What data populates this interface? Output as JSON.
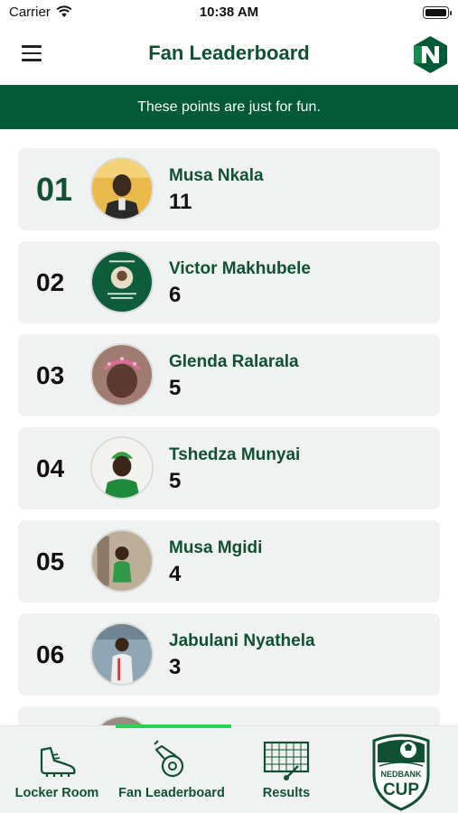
{
  "status_bar": {
    "carrier": "Carrier",
    "time": "10:38 AM"
  },
  "header": {
    "title": "Fan Leaderboard",
    "menu_icon": "hamburger-menu-icon",
    "logo": "nedbank-logo"
  },
  "banner": {
    "text": "These points are just for fun."
  },
  "leaderboard": [
    {
      "rank": "01",
      "name": "Musa Nkala",
      "points": "11",
      "avatar": "photo"
    },
    {
      "rank": "02",
      "name": "Victor Makhubele",
      "points": "6",
      "avatar": "card"
    },
    {
      "rank": "03",
      "name": "Glenda Ralarala",
      "points": "5",
      "avatar": "photo"
    },
    {
      "rank": "04",
      "name": "Tshedza Munyai",
      "points": "5",
      "avatar": "photo"
    },
    {
      "rank": "05",
      "name": "Musa Mgidi",
      "points": "4",
      "avatar": "photo"
    },
    {
      "rank": "06",
      "name": "Jabulani Nyathela",
      "points": "3",
      "avatar": "photo"
    }
  ],
  "tabs": [
    {
      "label": "Locker Room",
      "icon": "boot-icon"
    },
    {
      "label": "Fan Leaderboard",
      "icon": "whistle-icon",
      "active": true
    },
    {
      "label": "Results",
      "icon": "goal-net-icon"
    }
  ],
  "cup_logo": {
    "text_top": "NEDBANK",
    "text_bottom": "CUP"
  },
  "colors": {
    "brand_green": "#005a35",
    "text_green": "#0f5132",
    "active_tab_indicator": "#26d357",
    "card_background": "#f0f2f1"
  }
}
